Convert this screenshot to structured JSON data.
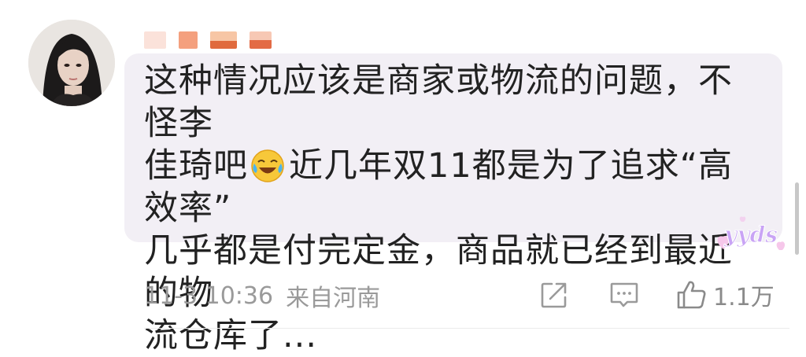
{
  "comment": {
    "line1": "这种情况应该是商家或物流的问题，不怪李",
    "line2_before_emoji": "佳琦吧",
    "emoji": "laughing-crying-emoji",
    "line2_after_emoji": "近几年双11都是为了追求“高效率”",
    "line3": "几乎都是付完定金，商品就已经到最近的物",
    "line4": "流仓库了..."
  },
  "sticker": {
    "text": "yyds"
  },
  "meta": {
    "time": "11-3 10:36",
    "location": "来自河南"
  },
  "actions": {
    "share_icon": "share-icon",
    "comment_icon": "comment-icon",
    "like_icon": "thumbs-up-icon",
    "like_count": "1.1万"
  },
  "colors": {
    "bubble": "#f2eff5",
    "text": "#222222",
    "meta": "#9a9a9a",
    "username_blocks": [
      "#fbe2da",
      "#f4a07e",
      "#f7c6a5",
      "#e06a3d",
      "#f7c8b4"
    ]
  }
}
